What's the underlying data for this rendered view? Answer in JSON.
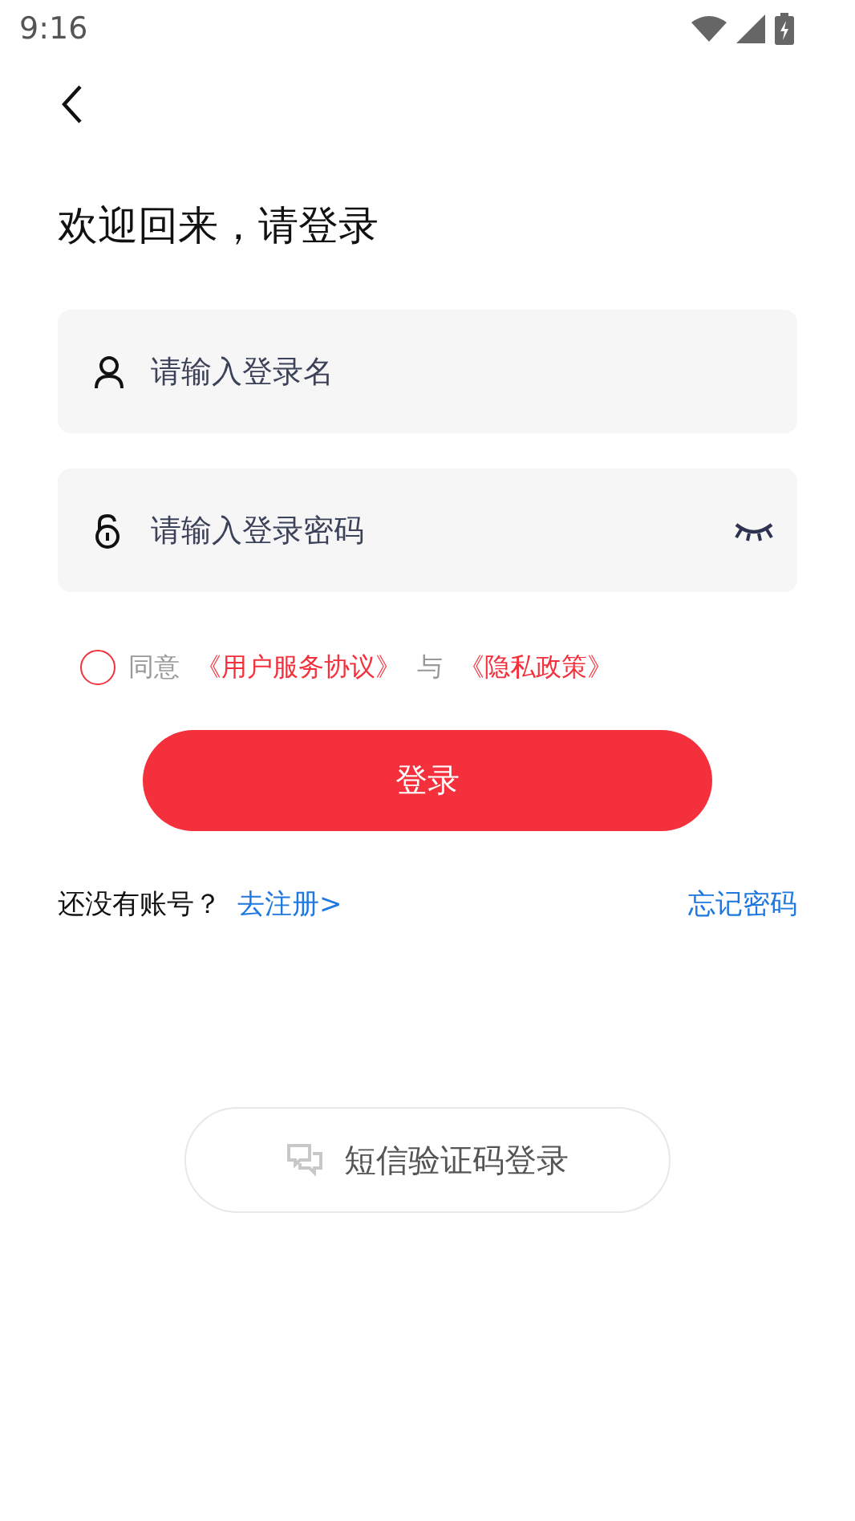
{
  "status_bar": {
    "time": "9:16"
  },
  "title": "欢迎回来，请登录",
  "fields": [
    {
      "kind": "user",
      "placeholder": "请输入登录名"
    },
    {
      "kind": "password",
      "placeholder": "请输入登录密码",
      "password_visible": false
    }
  ],
  "agreement": {
    "checked": false,
    "parts": [
      {
        "kind": "plain",
        "text": "同意"
      },
      {
        "kind": "link",
        "text": "《用户服务协议》"
      },
      {
        "kind": "plain",
        "text": "与"
      },
      {
        "kind": "link",
        "text": "《隐私政策》"
      }
    ]
  },
  "login_button": "登录",
  "register": {
    "prompt": "还没有账号？",
    "link": "去注册>"
  },
  "forgot_password": "忘记密码",
  "sms_login_button": "短信验证码登录"
}
